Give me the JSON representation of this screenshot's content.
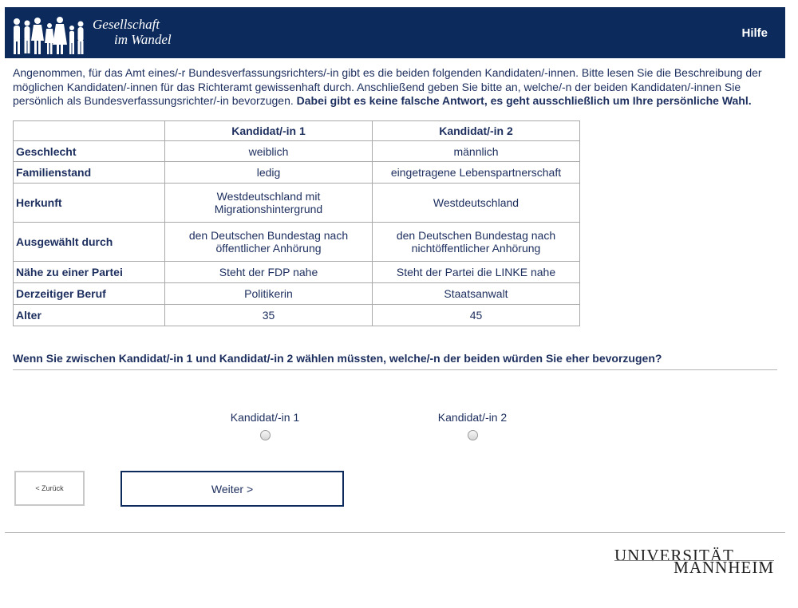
{
  "header": {
    "logo_line1": "Gesellschaft",
    "logo_line2": "im Wandel",
    "help_label": "Hilfe",
    "bg_color": "#0c2a5c",
    "logo_icon": "people-silhouettes-icon"
  },
  "intro": {
    "text": "Angenommen, für das Amt eines/-r Bundesverfassungsrichters/-in gibt es die beiden folgenden Kandidaten/-innen. Bitte lesen Sie die Beschreibung der möglichen Kandidaten/-innen für das Richteramt gewissenhaft durch. Anschließend geben Sie bitte an, welche/-n der beiden Kandidaten/-innen Sie persönlich als Bundesverfassungsrichter/-in bevorzugen. ",
    "bold": "Dabei gibt es keine falsche Antwort, es geht ausschließlich um Ihre persönliche Wahl."
  },
  "table": {
    "columns": [
      "",
      "Kandidat/-in 1",
      "Kandidat/-in 2"
    ],
    "rows": [
      {
        "label": "Geschlecht",
        "c1": "weiblich",
        "c2": "männlich"
      },
      {
        "label": "Familienstand",
        "c1": "ledig",
        "c2": "eingetragene Lebenspartnerschaft"
      },
      {
        "label": "Herkunft",
        "c1": "Westdeutschland mit Migrationshintergrund",
        "c2": "Westdeutschland"
      },
      {
        "label": "Ausgewählt durch",
        "c1": "den Deutschen Bundestag nach öffentlicher Anhörung",
        "c2": "den Deutschen Bundestag nach nichtöffentlicher Anhörung"
      },
      {
        "label": "Nähe zu einer Partei",
        "c1": "Steht der FDP nahe",
        "c2": "Steht der Partei die LINKE nahe"
      },
      {
        "label": "Derzeitiger Beruf",
        "c1": "Politikerin",
        "c2": "Staatsanwalt"
      },
      {
        "label": "Alter",
        "c1": "35",
        "c2": "45"
      }
    ]
  },
  "question": "Wenn Sie zwischen Kandidat/-in 1 und Kandidat/-in 2 wählen müssten, welche/-n der beiden würden Sie eher bevorzugen?",
  "options": [
    {
      "label": "Kandidat/-in 1",
      "selected": false
    },
    {
      "label": "Kandidat/-in 2",
      "selected": false
    }
  ],
  "buttons": {
    "back": "< Zurück",
    "next": "Weiter >"
  },
  "footer": {
    "logo_line1": "UNIVERSITÄT",
    "logo_line2": "MANNHEIM"
  }
}
